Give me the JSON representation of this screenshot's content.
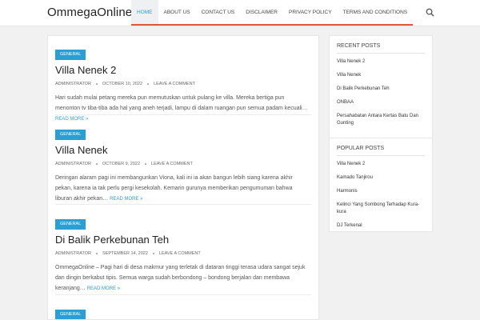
{
  "site": {
    "title": "OmmegaOnline"
  },
  "nav": {
    "items": [
      {
        "label": "HOME"
      },
      {
        "label": "ABOUT US"
      },
      {
        "label": "CONTACT US"
      },
      {
        "label": "DISCLAIMER"
      },
      {
        "label": "PRIVACY POLICY"
      },
      {
        "label": "TERMS AND CONDITIONS"
      }
    ],
    "search_icon": "search-icon"
  },
  "posts": [
    {
      "category": "GENERAL",
      "title": "Villa Nenek 2",
      "author": "ADMINISTRATOR",
      "date": "OCTOBER 10, 2022",
      "comment": "LEAVE A COMMENT",
      "excerpt": "Hari sudah mulai petang mereka pun memutuskan untuk pulang ke villa. Mereka bertiga pun menonton tv tiba-tiba ada hal yang aneh terjadi, lampu di dalam ruangan pun semua padam kecuali…",
      "more": "READ MORE »"
    },
    {
      "category": "GENERAL",
      "title": "Villa Nenek",
      "author": "ADMINISTRATOR",
      "date": "OCTOBER 9, 2022",
      "comment": "LEAVE A COMMENT",
      "excerpt": "Deringan alaram pagi ini membangunkan Viona, kali ini ia akan bangun lebih siang karena akhir pekan, karena ia tak perlu pergi kesekolah. Kemarin gurunya memberikan pengumuman bahwa liburan akhir pekan…",
      "more": "READ MORE »"
    },
    {
      "category": "GENERAL",
      "title": "Di Balik Perkebunan Teh",
      "author": "ADMINISTRATOR",
      "date": "SEPTEMBER 14, 2022",
      "comment": "LEAVE A COMMENT",
      "excerpt": "OmmegaOnline – Pagi hari di desa makmur yang terletak di dataran tinggi terasa udara sangat sejuk dan dingin berkabut tipis. Semua warga sudah berbondong – bondong berjalan dan membawa keranjang…",
      "more": "READ MORE »"
    },
    {
      "category": "GENERAL"
    }
  ],
  "sidebar": {
    "recent": {
      "title": "RECENT POSTS",
      "items": [
        "Villa Nenek 2",
        "Villa Nenek",
        "Di Balik Perkebunan Teh",
        "ONBAA",
        "Persahabatan Antara Kertas Batu Dan Gunting"
      ]
    },
    "popular": {
      "title": "POPULAR POSTS",
      "items": [
        "Villa Nenek 2",
        "Kamado Tanjirou",
        "Harmonis",
        "Kelinci Yang Sombong Terhadap Kura-kura",
        "DJ Terkenal"
      ]
    }
  },
  "colors": {
    "accent": "#2a9fd6",
    "nav_underline": "#e2563a",
    "background": "#f1f1f1"
  }
}
